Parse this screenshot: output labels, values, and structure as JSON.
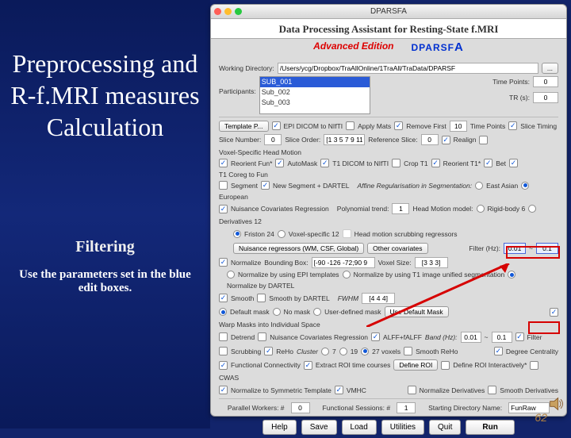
{
  "page": {
    "number": "62"
  },
  "sidebar": {
    "title": "Preprocessing and R-f.MRI measures Calculation",
    "sub1": "Filtering",
    "sub2": "Use the parameters set in the blue edit boxes."
  },
  "window": {
    "name": "DPARSFA",
    "appTitle": "Data Processing Assistant for Resting-State f.MRI",
    "advanced": "Advanced Edition",
    "brand": "DPARSF",
    "brandA": "A"
  },
  "wd": {
    "label": "Working Directory:",
    "value": "/Users/ycg/Dropbox/TraAllOnline/1TraAll/TraData/DPARSF"
  },
  "participants": {
    "label": "Participants:",
    "items": [
      "SUB_001",
      "Sub_002",
      "Sub_003"
    ],
    "selectedIndex": 0,
    "timePointsLabel": "Time Points:",
    "timePoints": "0",
    "trLabel": "TR (s):",
    "tr": "0"
  },
  "row1": {
    "templateBtn": "Template P...",
    "epidicom": "EPI DICOM to NIfTI",
    "applyMats": "Apply Mats",
    "removeFirst": "Remove First",
    "removeFirstVal": "10",
    "timePoints": "Time Points",
    "sliceTiming": "Slice Timing"
  },
  "row2": {
    "sliceNumber": "Slice Number:",
    "sliceNumberVal": "0",
    "sliceOrder": "Slice Order:",
    "sliceOrderVal": "[1 3 5 7 9 11",
    "refSlice": "Reference Slice:",
    "refSliceVal": "0",
    "realign": "Realign",
    "voxelHM": "Voxel-Specific Head Motion"
  },
  "row3": {
    "reorientFun": "Reorient Fun*",
    "autoMask": "AutoMask",
    "t1dicom": "T1 DICOM to NIfTI",
    "cropT1": "Crop T1",
    "reorientT1": "Reorient T1*",
    "bet": "Bet",
    "t1coreg": "T1 Coreg to Fun"
  },
  "row4": {
    "segment": "Segment",
    "newSegment": "New Segment + DARTEL",
    "affineReg": "Affine Regularisation in Segmentation:",
    "eastAsian": "East Asian",
    "european": "European"
  },
  "row5": {
    "nuisance": "Nuisance Covariates Regression",
    "polyTrend": "Polynomial trend:",
    "polyVal": "1",
    "hmModel": "Head Motion model:",
    "rigid6": "Rigid-body 6",
    "deriv12": "Derivatives 12"
  },
  "row6": {
    "friston": "Friston 24",
    "voxel12": "Voxel-specific 12",
    "scrub": "Head motion scrubbing regressors"
  },
  "row7": {
    "nr": "Nuisance regressors (WM, CSF, Global)",
    "other": "Other covariates",
    "filterL": "Filter (Hz):",
    "f1": "0.01",
    "tilde": "~",
    "f2": "0.1"
  },
  "row8": {
    "normalize": "Normalize",
    "bb": "Bounding Box:",
    "bbVal": "[-90 -126 -72;90 9",
    "vox": "Voxel Size:",
    "voxVal": "[3 3 3]"
  },
  "row9": {
    "epi": "Normalize by using EPI templates",
    "t1seg": "Normalize by using T1 image unified segmentation",
    "dartel": "Normalize by DARTEL"
  },
  "row10": {
    "smooth": "Smooth",
    "sd": "Smooth by DARTEL",
    "fwhm": "FWHM",
    "fwhmVal": "[4 4 4]"
  },
  "row11": {
    "defMask": "Default mask",
    "noMask": "No mask",
    "userMask": "User-defined mask",
    "useBtn": "Use Default Mask",
    "warp": "Warp Masks into Individual Space"
  },
  "row12": {
    "detrend": "Detrend",
    "nuisance2": "Nuisance Covariates Regression",
    "alff": "ALFF+fALFF",
    "band": "Band (Hz):",
    "b1": "0.01",
    "tilde": "~",
    "b2": "0.1",
    "filter": "Filter"
  },
  "row13": {
    "scrub": "Scrubbing",
    "reho": "ReHo",
    "cluster": "Cluster",
    "opt19": "19",
    "opt27": "27 voxels",
    "opt7": "7",
    "smooth": "Smooth ReHo",
    "dc": "Degree Centrality"
  },
  "row14": {
    "fc": "Functional Connectivity",
    "extract": "Extract ROI time courses",
    "defroi": "Define ROI",
    "defroi2": "Define ROI Interactively*",
    "cwas": "CWAS"
  },
  "row15": {
    "norm": "Normalize to Symmetric Template",
    "vmhc": "VMHC",
    "normderiv": "Normalize Derivatives",
    "smoothderiv": "Smooth Derivatives"
  },
  "footer": {
    "workers": "Parallel Workers:  #",
    "workersVal": "0",
    "sess": "Functional Sessions: #",
    "sessVal": "1",
    "start": "Starting Directory Name:",
    "startVal": "FunRaw"
  },
  "buttons": {
    "help": "Help",
    "save": "Save",
    "load": "Load",
    "util": "Utilities",
    "quit": "Quit",
    "run": "Run"
  }
}
